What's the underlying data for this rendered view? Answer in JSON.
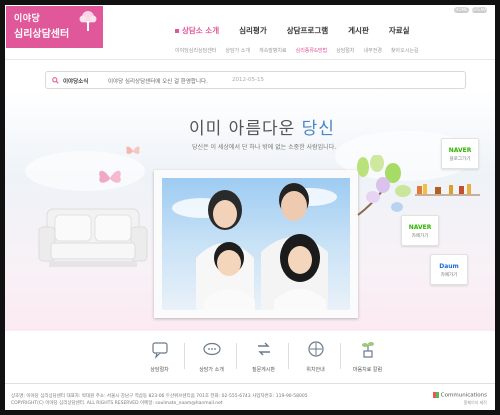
{
  "logo": {
    "line1": "이야당",
    "line2": "심리상담센터"
  },
  "top_buttons": [
    "HOME",
    "SITEMAP"
  ],
  "gnb": [
    {
      "label": "상담소 소개",
      "active": true
    },
    {
      "label": "심리평가",
      "active": false
    },
    {
      "label": "상담프로그램",
      "active": false
    },
    {
      "label": "게시판",
      "active": false
    },
    {
      "label": "자료실",
      "active": false
    }
  ],
  "lnb": [
    "이야당심리상담센터",
    "상담가 소개",
    "게속발병치료",
    "심리종류&방법",
    "상담절차",
    "내부전경",
    "찾아오시는길"
  ],
  "lnb_active_index": 3,
  "notice": {
    "label": "이야당소식",
    "text": "이야당 심리상담센터에 오신 걸 환영합니다.",
    "date": "2012-05-15"
  },
  "hero": {
    "headline_prefix": "이미 아름다운",
    "headline_accent": "당신",
    "subline": "당신은 이 세상에서 단 하나 밖에 없는 소중한 사람입니다."
  },
  "banners": [
    {
      "brand": "NAVER",
      "label": "블로그가기",
      "color": "#2db400"
    },
    {
      "brand": "NAVER",
      "label": "카페가기",
      "color": "#2db400"
    },
    {
      "brand": "Daum",
      "label": "카페가기",
      "color": "#1f6fd6"
    }
  ],
  "quick_menu": [
    {
      "label": "상담절차",
      "icon": "chat-icon"
    },
    {
      "label": "상담가 소개",
      "icon": "message-icon"
    },
    {
      "label": "질문게시판",
      "icon": "qa-icon"
    },
    {
      "label": "위치안내",
      "icon": "location-icon"
    },
    {
      "label": "마음치료 칼럼",
      "icon": "plant-icon"
    }
  ],
  "footer": {
    "line1": "상호명: 이야당 심리상담센터    대표자: 박대원    주소: 서울시 강남구 역삼동 823-06 두산위브센티움 701호    전화: 02-555-6743    사업자번호: 119-90-58005",
    "line2": "COPYRIGHT(C) 이야당 심리상담센터. ALL RIGHTS RESERVED    이메일: soulmate_naam@hanmail.net",
    "comm": "Communications",
    "made": "홈페이지 제작"
  },
  "colors": {
    "brand": "#e0579a",
    "accent": "#4a86c5"
  }
}
